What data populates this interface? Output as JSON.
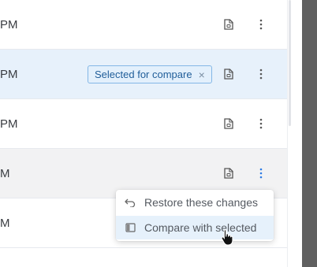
{
  "rows": [
    {
      "time": "PM"
    },
    {
      "time": "PM",
      "badge": "Selected for compare",
      "badge_close": "×"
    },
    {
      "time": "PM"
    },
    {
      "time": "M"
    },
    {
      "time": "M"
    }
  ],
  "context_menu": {
    "items": [
      {
        "label": "Restore these changes",
        "icon": "undo-icon"
      },
      {
        "label": "Compare with selected",
        "icon": "compare-panel-icon"
      }
    ]
  },
  "colors": {
    "selected_row": "#e7f1fb",
    "hover_row": "#f2f2f3",
    "badge_border": "#84b7e6",
    "badge_text": "#1f5d99",
    "active_more": "#2c7be5"
  }
}
